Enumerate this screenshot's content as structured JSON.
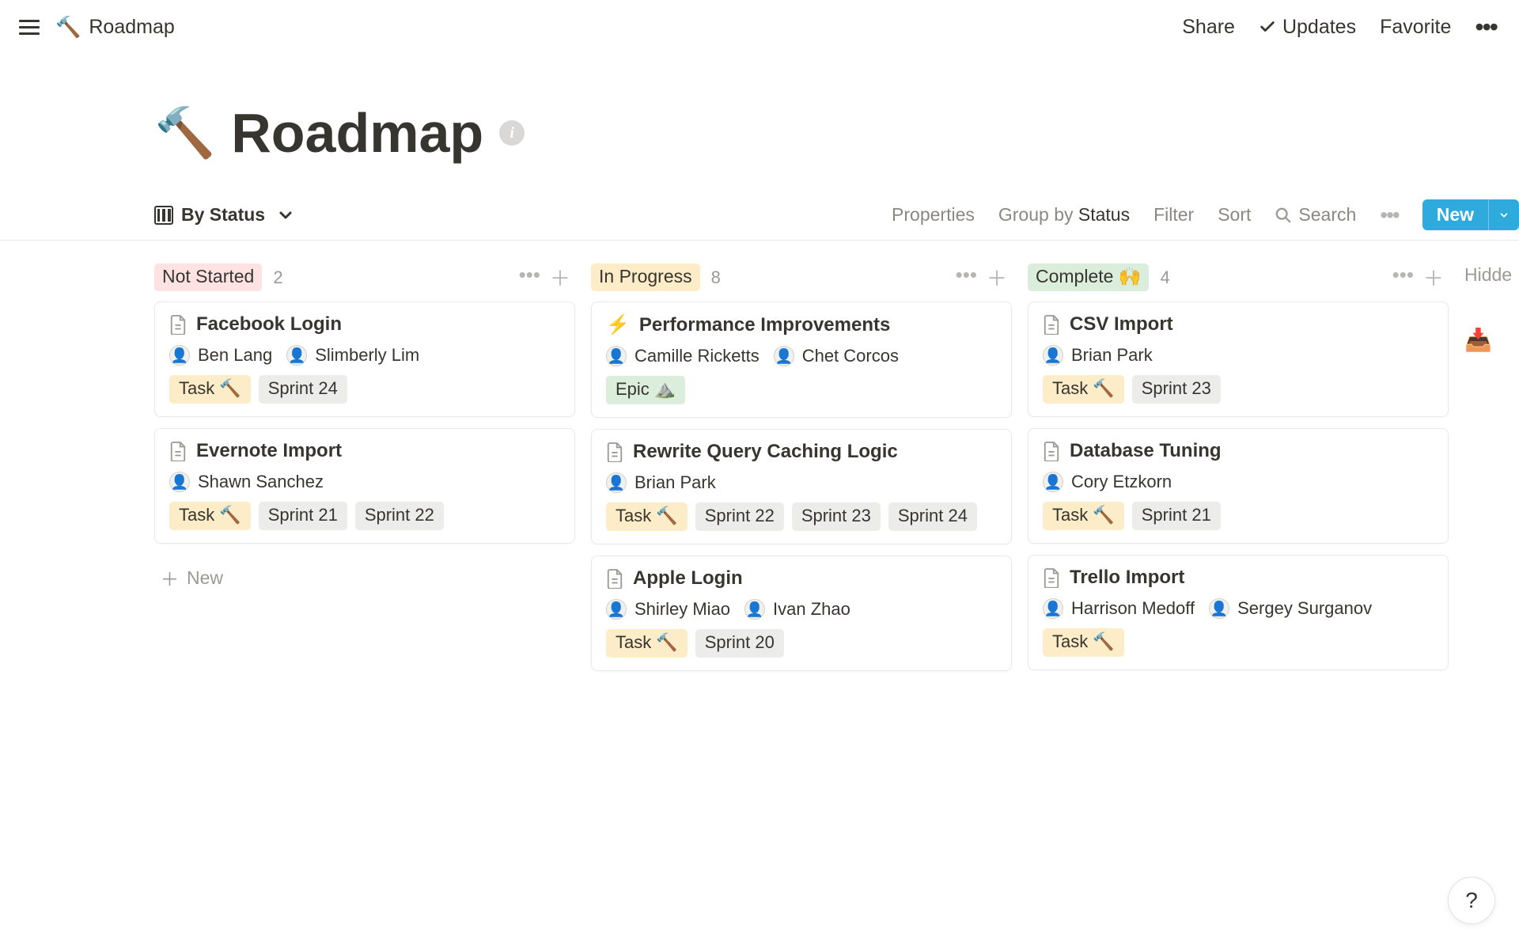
{
  "breadcrumb": {
    "icon": "🔨",
    "title": "Roadmap"
  },
  "topbar": {
    "share": "Share",
    "updates": "Updates",
    "favorite": "Favorite"
  },
  "page": {
    "icon": "🔨",
    "title": "Roadmap"
  },
  "toolbar": {
    "view_label": "By Status",
    "properties": "Properties",
    "group_by_prefix": "Group by ",
    "group_by_value": "Status",
    "filter": "Filter",
    "sort": "Sort",
    "search": "Search",
    "new": "New"
  },
  "hidden_label": "Hidde",
  "add_new_label": "New",
  "help_label": "?",
  "columns": [
    {
      "id": "notstarted",
      "label": "Not Started",
      "count": "2",
      "pill_class": "notstarted",
      "cards": [
        {
          "title": "Facebook Login",
          "emoji": "",
          "assignees": [
            "Ben Lang",
            "Slimberly Lim"
          ],
          "tags": [
            {
              "text": "Task 🔨",
              "cls": "task"
            },
            {
              "text": "Sprint 24",
              "cls": "sprint"
            }
          ]
        },
        {
          "title": "Evernote Import",
          "emoji": "",
          "assignees": [
            "Shawn Sanchez"
          ],
          "tags": [
            {
              "text": "Task 🔨",
              "cls": "task"
            },
            {
              "text": "Sprint 21",
              "cls": "sprint"
            },
            {
              "text": "Sprint 22",
              "cls": "sprint"
            }
          ]
        }
      ],
      "show_add": true
    },
    {
      "id": "inprogress",
      "label": "In Progress",
      "count": "8",
      "pill_class": "inprogress",
      "cards": [
        {
          "title": "Performance Improvements",
          "emoji": "⚡",
          "assignees": [
            "Camille Ricketts",
            "Chet Corcos"
          ],
          "tags": [
            {
              "text": "Epic ⛰️",
              "cls": "epic"
            }
          ]
        },
        {
          "title": "Rewrite Query Caching Logic",
          "emoji": "",
          "assignees": [
            "Brian Park"
          ],
          "tags": [
            {
              "text": "Task 🔨",
              "cls": "task"
            },
            {
              "text": "Sprint 22",
              "cls": "sprint"
            },
            {
              "text": "Sprint 23",
              "cls": "sprint"
            },
            {
              "text": "Sprint 24",
              "cls": "sprint"
            }
          ]
        },
        {
          "title": "Apple Login",
          "emoji": "",
          "assignees": [
            "Shirley Miao",
            "Ivan Zhao"
          ],
          "tags": [
            {
              "text": "Task 🔨",
              "cls": "task"
            },
            {
              "text": "Sprint 20",
              "cls": "sprint"
            }
          ]
        }
      ],
      "show_add": false
    },
    {
      "id": "complete",
      "label": "Complete 🙌",
      "count": "4",
      "pill_class": "complete",
      "cards": [
        {
          "title": "CSV Import",
          "emoji": "",
          "assignees": [
            "Brian Park"
          ],
          "tags": [
            {
              "text": "Task 🔨",
              "cls": "task"
            },
            {
              "text": "Sprint 23",
              "cls": "sprint"
            }
          ]
        },
        {
          "title": "Database Tuning",
          "emoji": "",
          "assignees": [
            "Cory Etzkorn"
          ],
          "tags": [
            {
              "text": "Task 🔨",
              "cls": "task"
            },
            {
              "text": "Sprint 21",
              "cls": "sprint"
            }
          ]
        },
        {
          "title": "Trello Import",
          "emoji": "",
          "assignees": [
            "Harrison Medoff",
            "Sergey Surganov"
          ],
          "tags": [
            {
              "text": "Task 🔨",
              "cls": "task"
            }
          ]
        }
      ],
      "show_add": false
    }
  ]
}
